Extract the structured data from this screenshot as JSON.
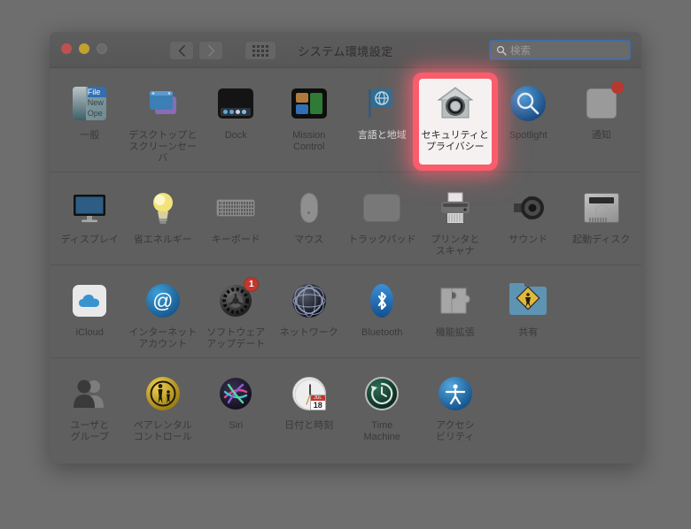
{
  "window": {
    "title": "システム環境設定",
    "traffic_lights": [
      "close",
      "minimize",
      "zoom"
    ],
    "nav": {
      "back": "back-arrow",
      "forward": "forward-arrow",
      "show_all": "grid-icon"
    },
    "search": {
      "placeholder": "検索",
      "value": "",
      "icon": "search-icon"
    }
  },
  "rows": [
    {
      "items": [
        {
          "label": "一般",
          "icon": "general-icon"
        },
        {
          "label": "デスクトップと\nスクリーンセーバ",
          "icon": "desktop-screensaver-icon"
        },
        {
          "label": "Dock",
          "icon": "dock-icon"
        },
        {
          "label": "Mission\nControl",
          "icon": "mission-control-icon"
        },
        {
          "label": "言語と地域",
          "icon": "language-region-icon"
        },
        {
          "label": "セキュリティと\nプライバシー",
          "icon": "security-privacy-icon",
          "highlighted": true
        },
        {
          "label": "Spotlight",
          "icon": "spotlight-icon"
        },
        {
          "label": "通知",
          "icon": "notifications-icon",
          "badge_dot": true
        }
      ]
    },
    {
      "items": [
        {
          "label": "ディスプレイ",
          "icon": "displays-icon"
        },
        {
          "label": "省エネルギー",
          "icon": "energy-saver-icon"
        },
        {
          "label": "キーボード",
          "icon": "keyboard-icon"
        },
        {
          "label": "マウス",
          "icon": "mouse-icon"
        },
        {
          "label": "トラックパッド",
          "icon": "trackpad-icon"
        },
        {
          "label": "プリンタと\nスキャナ",
          "icon": "printers-scanners-icon"
        },
        {
          "label": "サウンド",
          "icon": "sound-icon"
        },
        {
          "label": "起動ディスク",
          "icon": "startup-disk-icon"
        }
      ]
    },
    {
      "items": [
        {
          "label": "iCloud",
          "icon": "icloud-icon"
        },
        {
          "label": "インターネット\nアカウント",
          "icon": "internet-accounts-icon"
        },
        {
          "label": "ソフトウェア\nアップデート",
          "icon": "software-update-icon",
          "badge": "1"
        },
        {
          "label": "ネットワーク",
          "icon": "network-icon"
        },
        {
          "label": "Bluetooth",
          "icon": "bluetooth-icon"
        },
        {
          "label": "機能拡張",
          "icon": "extensions-icon"
        },
        {
          "label": "共有",
          "icon": "sharing-icon"
        }
      ]
    },
    {
      "items": [
        {
          "label": "ユーザと\nグループ",
          "icon": "users-groups-icon"
        },
        {
          "label": "ペアレンタル\nコントロール",
          "icon": "parental-controls-icon"
        },
        {
          "label": "Siri",
          "icon": "siri-icon"
        },
        {
          "label": "日付と時刻",
          "icon": "date-time-icon",
          "calendar_month": "JUL",
          "calendar_day": "18"
        },
        {
          "label": "Time\nMachine",
          "icon": "time-machine-icon"
        },
        {
          "label": "アクセシ\nビリティ",
          "icon": "accessibility-icon"
        }
      ]
    }
  ],
  "colors": {
    "desktop_background": "#6e6e6e",
    "window_background": "#5f5f5f",
    "highlight_glow": "#ff5c6c",
    "search_focus_ring": "#3f6ea8",
    "badge_red": "#c0392f"
  }
}
